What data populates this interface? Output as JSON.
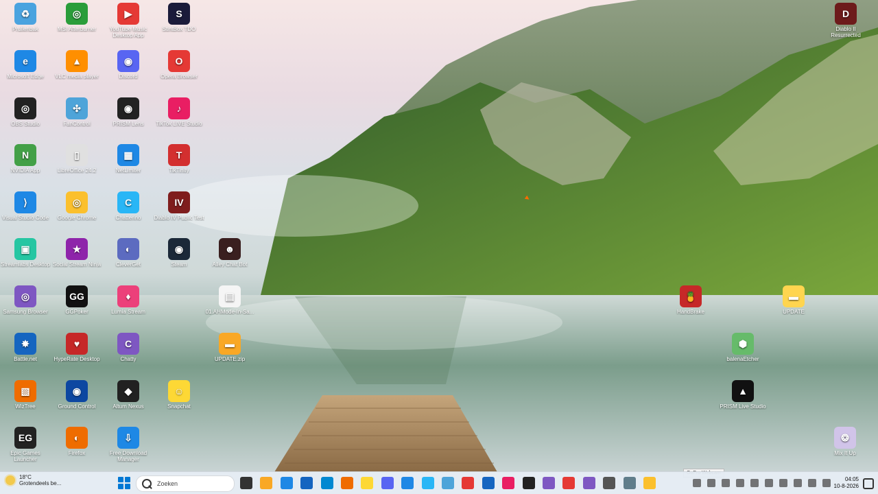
{
  "desktop": {
    "icons": [
      {
        "label": "Prullenbak",
        "color": "#4aa3df",
        "glyph": "♻"
      },
      {
        "label": "MSI Afterburner",
        "color": "#2a9d3a",
        "glyph": "◎"
      },
      {
        "label": "YouTube Music Desktop App",
        "color": "#e53935",
        "glyph": "▶"
      },
      {
        "label": "StintBox TDO",
        "color": "#1b1b3a",
        "glyph": "S"
      },
      {
        "label": "Microsoft Edge",
        "color": "#1e88e5",
        "glyph": "e"
      },
      {
        "label": "VLC media player",
        "color": "#ff8f00",
        "glyph": "▲"
      },
      {
        "label": "Discord",
        "color": "#5865F2",
        "glyph": "◉"
      },
      {
        "label": "Opera Browser",
        "color": "#e53935",
        "glyph": "O"
      },
      {
        "label": "OBS Studio",
        "color": "#222",
        "glyph": "◎"
      },
      {
        "label": "FanControl",
        "color": "#4ea4d9",
        "glyph": "✣"
      },
      {
        "label": "PRISM Lens",
        "color": "#222",
        "glyph": "◉"
      },
      {
        "label": "TikTok LIVE Studio",
        "color": "#e91e63",
        "glyph": "♪"
      },
      {
        "label": "NVIDIA App",
        "color": "#43a047",
        "glyph": "N"
      },
      {
        "label": "LibreOffice 24.2",
        "color": "#e0e0e0",
        "glyph": "▯"
      },
      {
        "label": "NetLimiter",
        "color": "#1e88e5",
        "glyph": "▦"
      },
      {
        "label": "TikTinity",
        "color": "#d32f2f",
        "glyph": "T"
      },
      {
        "label": "Visual Studio Code",
        "color": "#1e88e5",
        "glyph": "⟩"
      },
      {
        "label": "Google Chrome",
        "color": "#fbc02d",
        "glyph": "◎"
      },
      {
        "label": "Chatterino",
        "color": "#29b6f6",
        "glyph": "C"
      },
      {
        "label": "Diablo IV Public Test",
        "color": "#7f1d1d",
        "glyph": "IV"
      },
      {
        "label": "Streamlabs Desktop",
        "color": "#26c6a2",
        "glyph": "▣"
      },
      {
        "label": "Social Stream Ninja",
        "color": "#8e24aa",
        "glyph": "★"
      },
      {
        "label": "CleverGet",
        "color": "#5c6bc0",
        "glyph": "◐"
      },
      {
        "label": "Steam",
        "color": "#1b2838",
        "glyph": "◉"
      },
      {
        "label": "Alley Chat Bot",
        "color": "#3a1f1f",
        "glyph": "☻"
      },
      {
        "label": "Samsung Browser",
        "color": "#7e57c2",
        "glyph": "◎"
      },
      {
        "label": "GGPoker",
        "color": "#111",
        "glyph": "GG"
      },
      {
        "label": "Lumia Stream",
        "color": "#ec407a",
        "glyph": "♦"
      },
      {
        "label": "01.AHMode-In-Sa...",
        "color": "#f5f5f5",
        "glyph": "▤"
      },
      {
        "label": "Battle.net",
        "color": "#1565c0",
        "glyph": "✸"
      },
      {
        "label": "HypeRate Desktop",
        "color": "#c62828",
        "glyph": "♥"
      },
      {
        "label": "Chatty",
        "color": "#7e57c2",
        "glyph": "C"
      },
      {
        "label": "UPDATE.zip",
        "color": "#f9a825",
        "glyph": "▬"
      },
      {
        "label": "WizTree",
        "color": "#ef6c00",
        "glyph": "▧"
      },
      {
        "label": "Ground Control",
        "color": "#0d47a1",
        "glyph": "◉"
      },
      {
        "label": "Altum Nexus",
        "color": "#212121",
        "glyph": "◆"
      },
      {
        "label": "Snapchat",
        "color": "#fdd835",
        "glyph": "☺"
      },
      {
        "label": "Epic Games Launcher",
        "color": "#222",
        "glyph": "EG"
      },
      {
        "label": "Firefox",
        "color": "#ef6c00",
        "glyph": "◐"
      },
      {
        "label": "Free Download Manager",
        "color": "#1e88e5",
        "glyph": "⇩"
      },
      {
        "label": "Diablo II Resurrected",
        "color": "#6d1b1b",
        "glyph": "D"
      },
      {
        "label": "HandBrake",
        "color": "#c62828",
        "glyph": "🍍"
      },
      {
        "label": "UPDATE",
        "color": "#ffd54f",
        "glyph": "▬"
      },
      {
        "label": "balenaEtcher",
        "color": "#66bb6a",
        "glyph": "⬢"
      },
      {
        "label": "PRISM Live Studio",
        "color": "#111",
        "glyph": "▲"
      },
      {
        "label": "Mix It Up",
        "color": "#d1c4e9",
        "glyph": "❂"
      }
    ]
  },
  "taskbar": {
    "weather_temp": "18°C",
    "weather_desc": "Grotendeels be...",
    "search_placeholder": "Zoeken",
    "pinned": [
      {
        "name": "task-view",
        "color": "#333"
      },
      {
        "name": "file-explorer",
        "color": "#f9a825"
      },
      {
        "name": "edge",
        "color": "#1e88e5"
      },
      {
        "name": "calculator",
        "color": "#1565c0"
      },
      {
        "name": "outlook",
        "color": "#0288d1"
      },
      {
        "name": "firefox",
        "color": "#ef6c00"
      },
      {
        "name": "snapchat",
        "color": "#fdd835"
      },
      {
        "name": "discord",
        "color": "#5865F2"
      },
      {
        "name": "netlimiter",
        "color": "#1e88e5"
      },
      {
        "name": "chatterino",
        "color": "#29b6f6"
      },
      {
        "name": "fan-control",
        "color": "#4ea4d9"
      },
      {
        "name": "opera",
        "color": "#e53935"
      },
      {
        "name": "word-app",
        "color": "#1565c0"
      },
      {
        "name": "tiktok-live",
        "color": "#e91e63"
      },
      {
        "name": "obs",
        "color": "#222"
      },
      {
        "name": "visual-studio",
        "color": "#7e57c2"
      },
      {
        "name": "youtube-music",
        "color": "#e53935"
      },
      {
        "name": "chatty",
        "color": "#7e57c2"
      },
      {
        "name": "app-generic",
        "color": "#555"
      },
      {
        "name": "settings",
        "color": "#607d8b"
      },
      {
        "name": "chrome",
        "color": "#fbc02d"
      }
    ],
    "time": "04:05",
    "date": "10-8-2026",
    "tooltip": "GoPro Webcam"
  }
}
